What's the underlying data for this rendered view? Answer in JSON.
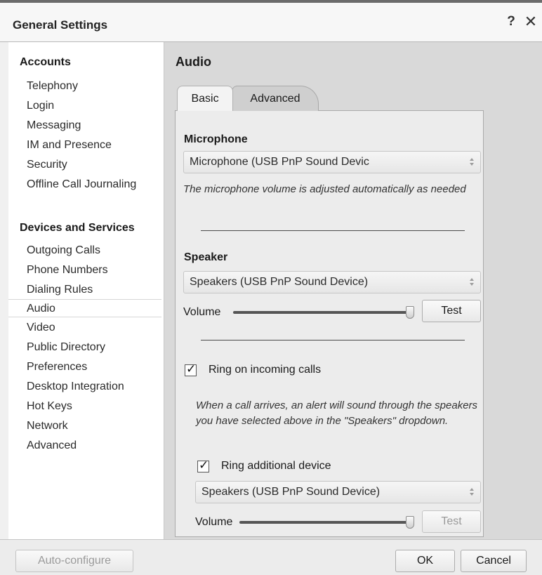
{
  "window": {
    "title": "General Settings",
    "help_glyph": "?",
    "close_glyph": "✕"
  },
  "sidebar": {
    "groups": [
      {
        "title": "Accounts",
        "items": [
          "Telephony",
          "Login",
          "Messaging",
          "IM and Presence",
          "Security",
          "Offline Call Journaling"
        ]
      },
      {
        "title": "Devices and Services",
        "items": [
          "Outgoing Calls",
          "Phone Numbers",
          "Dialing Rules",
          "Audio",
          "Video",
          "Public Directory",
          "Preferences",
          "Desktop Integration",
          "Hot Keys",
          "Network",
          "Advanced"
        ]
      }
    ],
    "selected": "Audio"
  },
  "main": {
    "title": "Audio",
    "tabs": [
      {
        "label": "Basic",
        "active": true
      },
      {
        "label": "Advanced",
        "active": false
      }
    ],
    "microphone": {
      "label": "Microphone",
      "device": "Microphone (USB PnP Sound Devic",
      "note": "The microphone volume is adjusted automatically as needed"
    },
    "speaker": {
      "label": "Speaker",
      "device": "Speakers (USB PnP Sound Device)",
      "volume_label": "Volume",
      "volume_level": 1.0,
      "test_label": "Test"
    },
    "ring": {
      "checkbox_label": "Ring on incoming calls",
      "checked": true,
      "note": "When a call arrives, an alert will sound through the speakers you have selected above in the \"Speakers\" dropdown.",
      "additional": {
        "checkbox_label": "Ring additional device",
        "checked": true,
        "device": "Speakers (USB PnP Sound Device)",
        "volume_label": "Volume",
        "volume_level": 1.0,
        "test_label": "Test"
      }
    }
  },
  "footer": {
    "auto_configure_label": "Auto-configure",
    "ok_label": "OK",
    "cancel_label": "Cancel"
  }
}
